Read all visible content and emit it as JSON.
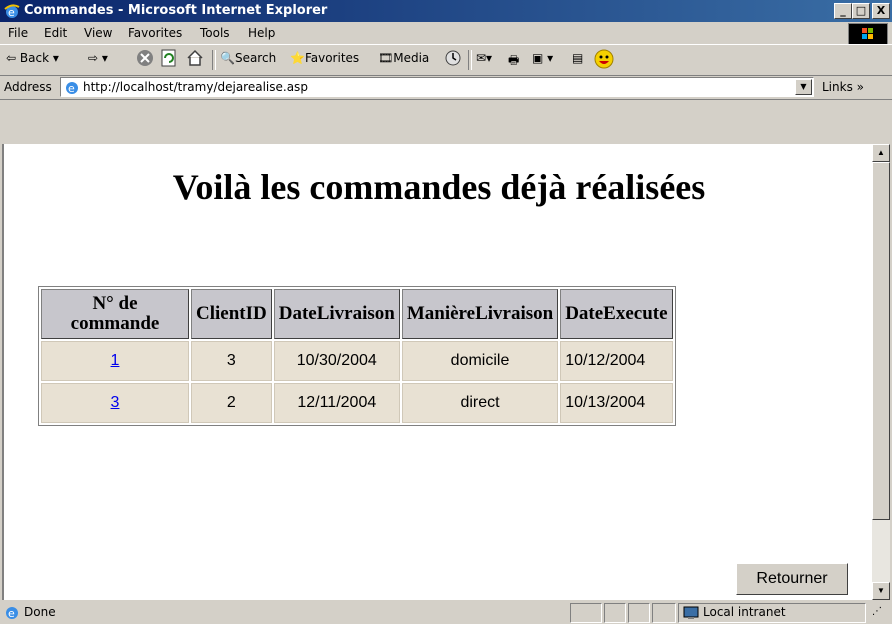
{
  "window": {
    "title": "Commandes - Microsoft Internet Explorer",
    "minimize": "_",
    "maximize": "□",
    "close": "X"
  },
  "menu": [
    "File",
    "Edit",
    "View",
    "Favorites",
    "Tools",
    "Help"
  ],
  "toolbar": {
    "back": "Back",
    "search": "Search",
    "favorites": "Favorites",
    "media": "Media"
  },
  "address": {
    "label": "Address",
    "url": "http://localhost/tramy/dejarealise.asp",
    "links": "Links"
  },
  "page": {
    "heading": "Voilà les commandes déjà réalisées",
    "table": {
      "headers": [
        "N° de commande",
        "ClientID",
        "DateLivraison",
        "ManièreLivraison",
        "DateExecute"
      ],
      "rows": [
        [
          "1",
          "3",
          "10/30/2004",
          "domicile",
          "10/12/2004"
        ],
        [
          "3",
          "2",
          "12/11/2004",
          "direct",
          "10/13/2004"
        ]
      ]
    },
    "return_button": "Retourner"
  },
  "status": {
    "text": "Done",
    "zone": "Local intranet"
  },
  "colors": {
    "titlebar": "#0a246a",
    "header_cell": "#c7c6cc",
    "data_cell": "#e8e1d3",
    "link": "#0000ee"
  }
}
